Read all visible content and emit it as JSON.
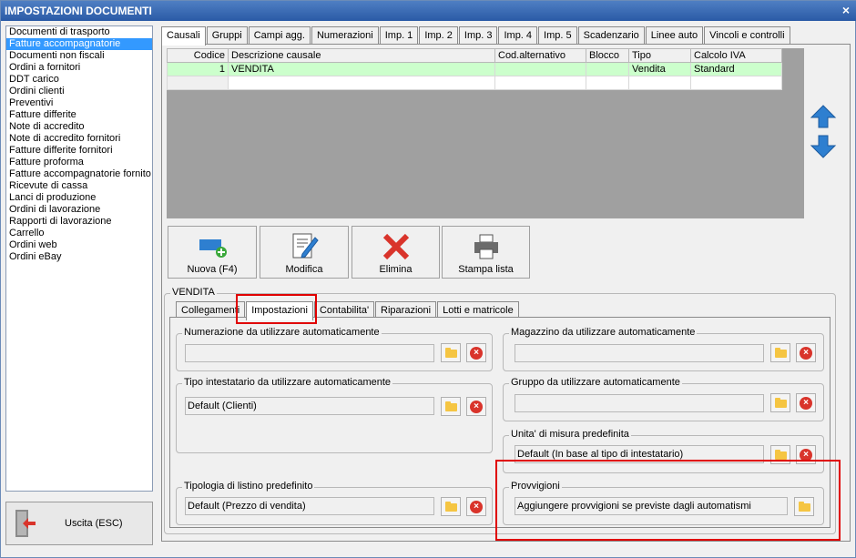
{
  "window": {
    "title": "IMPOSTAZIONI DOCUMENTI"
  },
  "sidebar": {
    "items": [
      {
        "label": "Documenti di trasporto"
      },
      {
        "label": "Fatture accompagnatorie"
      },
      {
        "label": "Documenti non fiscali"
      },
      {
        "label": "Ordini a fornitori"
      },
      {
        "label": "DDT carico"
      },
      {
        "label": "Ordini clienti"
      },
      {
        "label": "Preventivi"
      },
      {
        "label": "Fatture differite"
      },
      {
        "label": "Note di accredito"
      },
      {
        "label": "Note di accredito fornitori"
      },
      {
        "label": "Fatture differite fornitori"
      },
      {
        "label": "Fatture proforma"
      },
      {
        "label": "Fatture accompagnatorie fornito"
      },
      {
        "label": "Ricevute di cassa"
      },
      {
        "label": "Lanci di produzione"
      },
      {
        "label": "Ordini di lavorazione"
      },
      {
        "label": "Rapporti di lavorazione"
      },
      {
        "label": "Carrello"
      },
      {
        "label": "Ordini web"
      },
      {
        "label": "Ordini eBay"
      }
    ],
    "exit_label": "Uscita (ESC)"
  },
  "main_tabs": [
    "Causali",
    "Gruppi",
    "Campi agg.",
    "Numerazioni",
    "Imp. 1",
    "Imp. 2",
    "Imp. 3",
    "Imp. 4",
    "Imp. 5",
    "Scadenzario",
    "Linee auto",
    "Vincoli e controlli"
  ],
  "grid": {
    "headers": [
      "Codice",
      "Descrizione causale",
      "Cod.alternativo",
      "Blocco",
      "Tipo",
      "Calcolo IVA"
    ],
    "rows": [
      [
        "1",
        "VENDITA",
        "",
        "",
        "Vendita",
        "Standard"
      ]
    ]
  },
  "actions": {
    "new": "Nuova (F4)",
    "edit": "Modifica",
    "delete": "Elimina",
    "print": "Stampa lista"
  },
  "detail": {
    "group_title": "VENDITA",
    "tabs": [
      "Collegamenti",
      "Impostazioni",
      "Contabilita'",
      "Riparazioni",
      "Lotti e matricole"
    ],
    "numerazione": {
      "title": "Numerazione da utilizzare automaticamente",
      "value": ""
    },
    "tipo_intestatario": {
      "title": "Tipo intestatario da utilizzare automaticamente",
      "value": "Default (Clienti)"
    },
    "tipologia_listino": {
      "title": "Tipologia di listino predefinito",
      "value": "Default (Prezzo di vendita)"
    },
    "magazzino": {
      "title": "Magazzino da utilizzare automaticamente",
      "value": ""
    },
    "gruppo": {
      "title": "Gruppo da utilizzare automaticamente",
      "value": ""
    },
    "unita_misura": {
      "title": "Unita' di misura predefinita",
      "value": "Default (In base al tipo di intestatario)"
    },
    "provvigioni": {
      "title": "Provvigioni",
      "value": "Aggiungere provvigioni se previste dagli automatismi"
    }
  }
}
